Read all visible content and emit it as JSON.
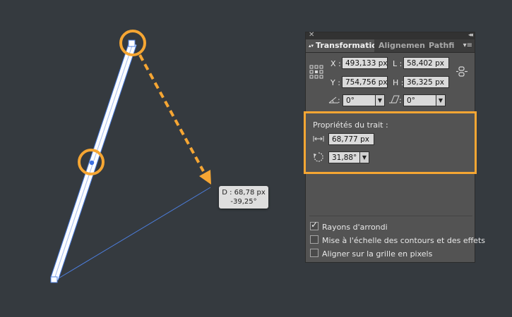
{
  "canvas": {
    "tooltip": {
      "distance": "D : 68,78 px",
      "angle": "-39,25°"
    }
  },
  "panel": {
    "tabs": [
      {
        "label": "Transformation",
        "active": true
      },
      {
        "label": "Alignement",
        "active": false
      },
      {
        "label": "Pathfi",
        "active": false
      }
    ],
    "fields": {
      "x": {
        "label": "X :",
        "value": "493,133 px"
      },
      "w": {
        "label": "L :",
        "value": "58,402 px"
      },
      "y": {
        "label": "Y :",
        "value": "754,756 px"
      },
      "h": {
        "label": "H :",
        "value": "36,325 px"
      },
      "rotate": {
        "value": "0°"
      },
      "shear": {
        "value": "0°"
      }
    },
    "stroke_props": {
      "title": "Propriétés du trait :",
      "width": "68,777 px",
      "angle": "31,88°"
    },
    "options": [
      {
        "label": "Rayons d'arrondi",
        "checked": true
      },
      {
        "label": "Mise à l'échelle des contours et des effets",
        "checked": false
      },
      {
        "label": "Aligner sur la grille en pixels",
        "checked": false
      }
    ]
  },
  "colors": {
    "highlight": "#f6a633",
    "guide": "#4d7fe0",
    "background": "#353a3f"
  }
}
